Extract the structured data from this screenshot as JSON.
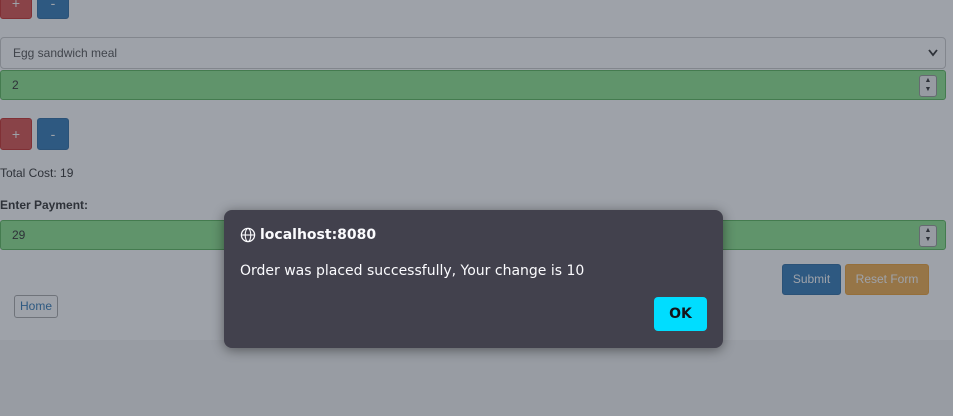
{
  "form": {
    "top_buttons": {
      "plus": "+",
      "minus": "-"
    },
    "item_select": {
      "value": "Egg sandwich meal",
      "chevron": "chevron-down-icon"
    },
    "quantity": {
      "value": "2"
    },
    "buttons": {
      "plus": "+",
      "minus": "-"
    },
    "total_cost": "Total Cost: 19",
    "payment_label": "Enter Payment:",
    "payment": {
      "value": "29"
    },
    "submit_label": "Submit",
    "reset_label": "Reset Form",
    "home_label": "Home"
  },
  "dialog": {
    "origin": "localhost:8080",
    "origin_icon": "globe-icon",
    "message": "Order was placed successfully, Your change is 10",
    "ok_label": "OK"
  },
  "colors": {
    "plus_button": "#d9534f",
    "minus_button": "#337ab7",
    "valid_field": "#8ee58e",
    "reset_button": "#f0ad4e",
    "dialog_bg": "#42414d",
    "dialog_ok": "#00ddff"
  }
}
